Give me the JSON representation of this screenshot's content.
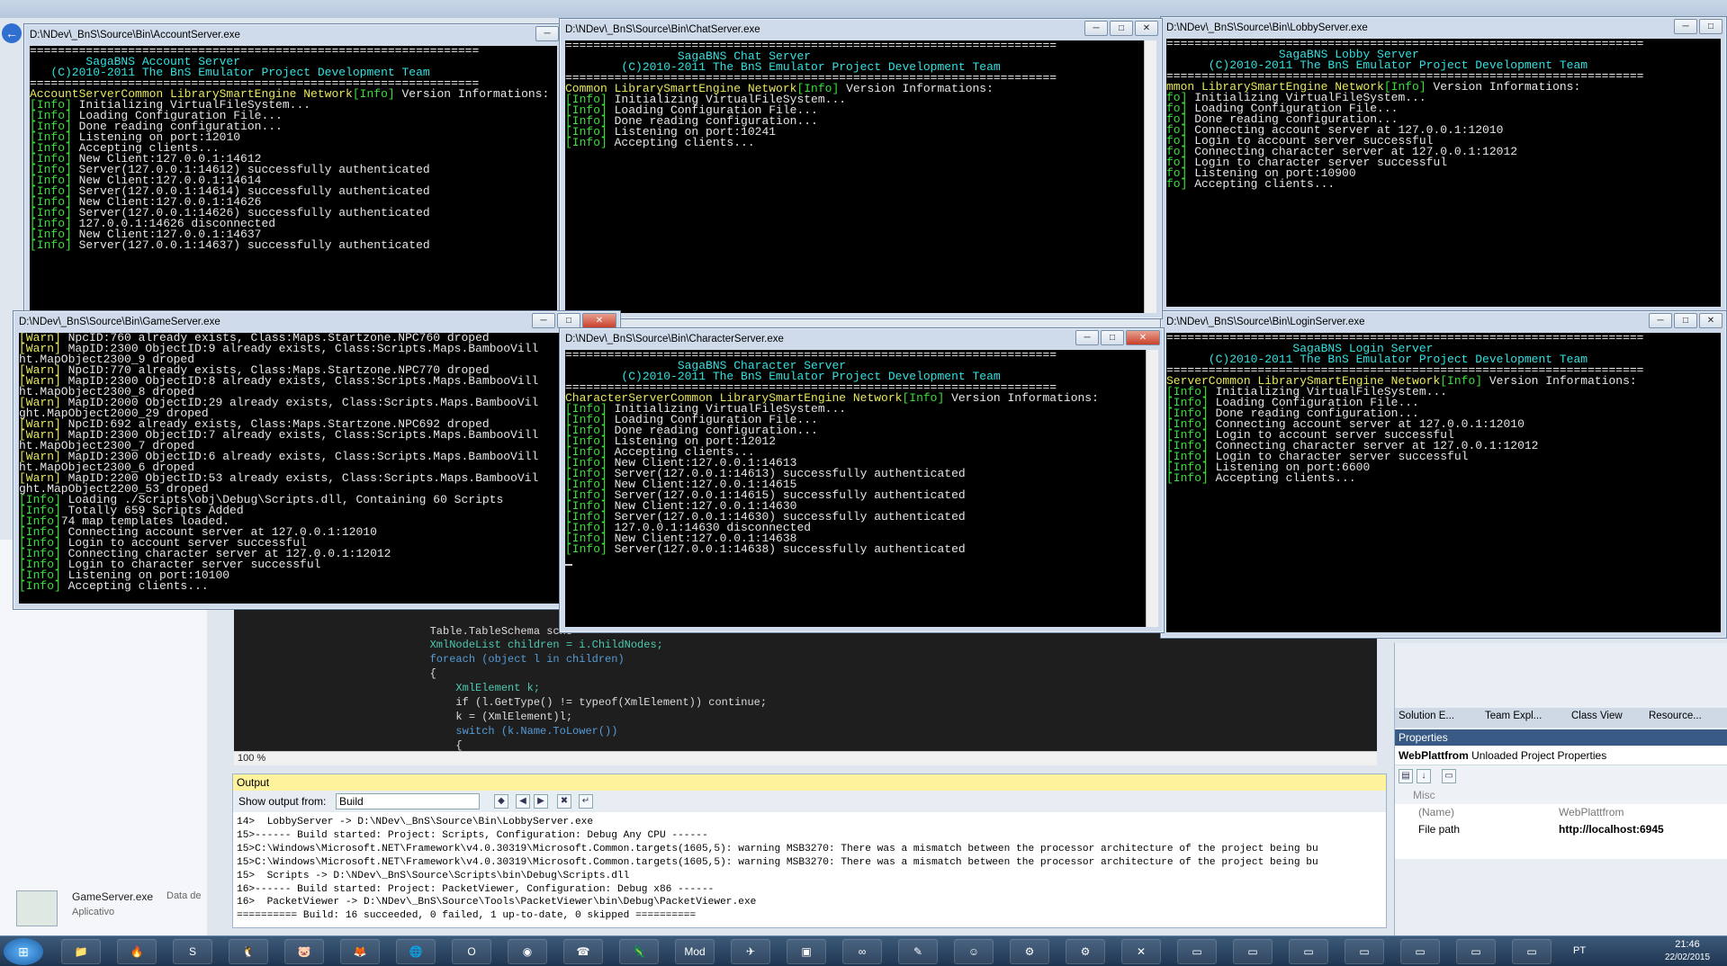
{
  "background": {
    "back_symbol": "←",
    "gameserver_item": {
      "name": "GameServer.exe",
      "type": "Aplicativo",
      "date_label": "Data de"
    },
    "code_lines": [
      "        Table.TableSchema sche",
      "        XmlNodeList children = i.ChildNodes;",
      "        foreach (object l in children)",
      "        {",
      "            XmlElement k;",
      "            if (l.GetType() != typeof(XmlElement)) continue;",
      "            k = (XmlElement)l;",
      "            switch (k.Name.ToLower())",
      "            {"
    ],
    "zoom": "100 %"
  },
  "output": {
    "title": "Output",
    "show_label": "Show output from:",
    "source": "Build",
    "lines": [
      "14>  LobbyServer -> D:\\NDev\\_BnS\\Source\\Bin\\LobbyServer.exe",
      "15>------ Build started: Project: Scripts, Configuration: Debug Any CPU ------",
      "15>C:\\Windows\\Microsoft.NET\\Framework\\v4.0.30319\\Microsoft.Common.targets(1605,5): warning MSB3270: There was a mismatch between the processor architecture of the project being bu",
      "15>C:\\Windows\\Microsoft.NET\\Framework\\v4.0.30319\\Microsoft.Common.targets(1605,5): warning MSB3270: There was a mismatch between the processor architecture of the project being bu",
      "15>  Scripts -> D:\\NDev\\_BnS\\Source\\Scripts\\bin\\Debug\\Scripts.dll",
      "16>------ Build started: Project: PacketViewer, Configuration: Debug x86 ------",
      "16>  PacketViewer -> D:\\NDev\\_BnS\\Source\\Tools\\PacketViewer\\bin\\Debug\\PacketViewer.exe",
      "========== Build: 16 succeeded, 0 failed, 1 up-to-date, 0 skipped =========="
    ]
  },
  "dock": {
    "tabs": [
      "Solution E...",
      "Team Expl...",
      "Class View",
      "Resource..."
    ],
    "properties_title": "Properties",
    "object_name": "WebPlattfrom",
    "object_type": "Unloaded Project Properties",
    "category": "Misc",
    "props": [
      {
        "name": "(Name)",
        "value": "WebPlattfrom"
      },
      {
        "name": "File path",
        "value": "http://localhost:6945"
      }
    ]
  },
  "windows": {
    "account": {
      "title": "D:\\NDev\\_BnS\\Source\\Bin\\AccountServer.exe",
      "header1": "        SagaBNS Account Server",
      "header2": "   (C)2010-2011 The BnS Emulator Project Development Team",
      "sep": "================================================================",
      "lead": "AccountServerCommon LibrarySmartEngine Network",
      "lead_info": "[Info]",
      "lead_tail": " Version Informations:",
      "lines": [
        " Initializing VirtualFileSystem...",
        " Loading Configuration File...",
        " Done reading configuration...",
        " Listening on port:12010",
        " Accepting clients...",
        " New Client:127.0.0.1:14612",
        " Server(127.0.0.1:14612) successfully authenticated",
        " New Client:127.0.0.1:14614",
        " Server(127.0.0.1:14614) successfully authenticated",
        " New Client:127.0.0.1:14626",
        " Server(127.0.0.1:14626) successfully authenticated",
        " 127.0.0.1:14626 disconnected",
        " New Client:127.0.0.1:14637",
        " Server(127.0.0.1:14637) successfully authenticated"
      ]
    },
    "chat": {
      "title": "D:\\NDev\\_BnS\\Source\\Bin\\ChatServer.exe",
      "header1": "                SagaBNS Chat Server",
      "header2": "        (C)2010-2011 The BnS Emulator Project Development Team",
      "sep": "======================================================================",
      "lead": "Common LibrarySmartEngine Network",
      "lead_info": "[Info]",
      "lead_tail": " Version Informations:",
      "lines": [
        " Initializing VirtualFileSystem...",
        " Loading Configuration File...",
        " Done reading configuration...",
        " Listening on port:10241",
        " Accepting clients..."
      ]
    },
    "lobby": {
      "title": "D:\\NDev\\_BnS\\Source\\Bin\\LobbyServer.exe",
      "header1": "                SagaBNS Lobby Server",
      "header2": "      (C)2010-2011 The BnS Emulator Project Development Team",
      "sep": "====================================================================",
      "lead": "mmon LibrarySmartEngine Network",
      "lead_info": "[Info]",
      "lead_tail": " Version Informations:",
      "prefix": "fo]",
      "lines": [
        " Initializing VirtualFileSystem...",
        " Loading Configuration File...",
        " Done reading configuration...",
        " Connecting account server at 127.0.0.1:12010",
        " Login to account server successful",
        " Connecting character server at 127.0.0.1:12012",
        " Login to character server successful",
        " Listening on port:10900",
        " Accepting clients..."
      ]
    },
    "game": {
      "title": "D:\\NDev\\_BnS\\Source\\Bin\\GameServer.exe",
      "rows": [
        {
          "tag": "[Warn]",
          "text": " NpcID:760 already exists, Class:Maps.Startzone.NPC760 droped"
        },
        {
          "tag": "[Warn]",
          "text": " MapID:2300 ObjectID:9 already exists, Class:Scripts.Maps.BambooVill"
        },
        {
          "tag": "",
          "text": "ht.MapObject2300_9 droped"
        },
        {
          "tag": "[Warn]",
          "text": " NpcID:770 already exists, Class:Maps.Startzone.NPC770 droped"
        },
        {
          "tag": "[Warn]",
          "text": " MapID:2300 ObjectID:8 already exists, Class:Scripts.Maps.BambooVill"
        },
        {
          "tag": "",
          "text": "ht.MapObject2300_8 droped"
        },
        {
          "tag": "[Warn]",
          "text": " MapID:2000 ObjectID:29 already exists, Class:Scripts.Maps.BambooVil"
        },
        {
          "tag": "",
          "text": "ght.MapObject2000_29 droped"
        },
        {
          "tag": "[Warn]",
          "text": " NpcID:692 already exists, Class:Maps.Startzone.NPC692 droped"
        },
        {
          "tag": "[Warn]",
          "text": " MapID:2300 ObjectID:7 already exists, Class:Scripts.Maps.BambooVill"
        },
        {
          "tag": "",
          "text": "ht.MapObject2300_7 droped"
        },
        {
          "tag": "[Warn]",
          "text": " MapID:2300 ObjectID:6 already exists, Class:Scripts.Maps.BambooVill"
        },
        {
          "tag": "",
          "text": "ht.MapObject2300_6 droped"
        },
        {
          "tag": "[Warn]",
          "text": " MapID:2200 ObjectID:53 already exists, Class:Scripts.Maps.BambooVil"
        },
        {
          "tag": "",
          "text": "ght.MapObject2200_53 droped"
        },
        {
          "tag": "[Info]",
          "text": " Loading ./Scripts\\obj\\Debug\\Scripts.dll, Containing 60 Scripts"
        },
        {
          "tag": "[Info]",
          "text": " Totally 659 Scripts Added"
        },
        {
          "tag": "[Info]",
          "text": "74 map templates loaded."
        },
        {
          "tag": "[Info]",
          "text": " Connecting account server at 127.0.0.1:12010"
        },
        {
          "tag": "[Info]",
          "text": " Login to account server successful"
        },
        {
          "tag": "[Info]",
          "text": " Connecting character server at 127.0.0.1:12012"
        },
        {
          "tag": "[Info]",
          "text": " Login to character server successful"
        },
        {
          "tag": "[Info]",
          "text": " Listening on port:10100"
        },
        {
          "tag": "[Info]",
          "text": " Accepting clients..."
        }
      ]
    },
    "character": {
      "title": "D:\\NDev\\_BnS\\Source\\Bin\\CharacterServer.exe",
      "header1": "                SagaBNS Character Server",
      "header2": "        (C)2010-2011 The BnS Emulator Project Development Team",
      "sep": "======================================================================",
      "lead": "CharacterServerCommon LibrarySmartEngine Network",
      "lead_info": "[Info]",
      "lead_tail": " Version Informations:",
      "lines": [
        " Initializing VirtualFileSystem...",
        " Loading Configuration File...",
        " Done reading configuration...",
        " Listening on port:12012",
        " Accepting clients...",
        " New Client:127.0.0.1:14613",
        " Server(127.0.0.1:14613) successfully authenticated",
        " New Client:127.0.0.1:14615",
        " Server(127.0.0.1:14615) successfully authenticated",
        " New Client:127.0.0.1:14630",
        " Server(127.0.0.1:14630) successfully authenticated",
        " 127.0.0.1:14630 disconnected",
        " New Client:127.0.0.1:14638",
        " Server(127.0.0.1:14638) successfully authenticated"
      ]
    },
    "login": {
      "title": "D:\\NDev\\_BnS\\Source\\Bin\\LoginServer.exe",
      "header1": "                  SagaBNS Login Server",
      "header2": "      (C)2010-2011 The BnS Emulator Project Development Team",
      "sep": "====================================================================",
      "lead": "ServerCommon LibrarySmartEngine Network",
      "lead_info": "[Info]",
      "lead_tail": " Version Informations:",
      "lines": [
        " Initializing VirtualFileSystem...",
        " Loading Configuration File...",
        " Done reading configuration...",
        " Connecting account server at 127.0.0.1:12010",
        " Login to account server successful",
        " Connecting character server at 127.0.0.1:12012",
        " Login to character server successful",
        " Listening on port:6600",
        " Accepting clients..."
      ]
    }
  },
  "info_tag": "[Info]",
  "win_controls": {
    "min": "─",
    "max": "□",
    "close": "✕"
  },
  "taskbar": {
    "start": "⊞",
    "apps": [
      "📁",
      "🔥",
      "S",
      "🐧",
      "🐷",
      "🦊",
      "🌐",
      "O",
      "◉",
      "☎",
      "🦎",
      "Mod",
      "✈",
      "▣",
      "∞",
      "✎",
      "☺",
      "⚙",
      "⚙",
      "✕",
      "▭",
      "▭",
      "▭",
      "▭",
      "▭",
      "▭",
      "▭"
    ],
    "lang": "PT",
    "time": "21:46",
    "date": "22/02/2015"
  }
}
